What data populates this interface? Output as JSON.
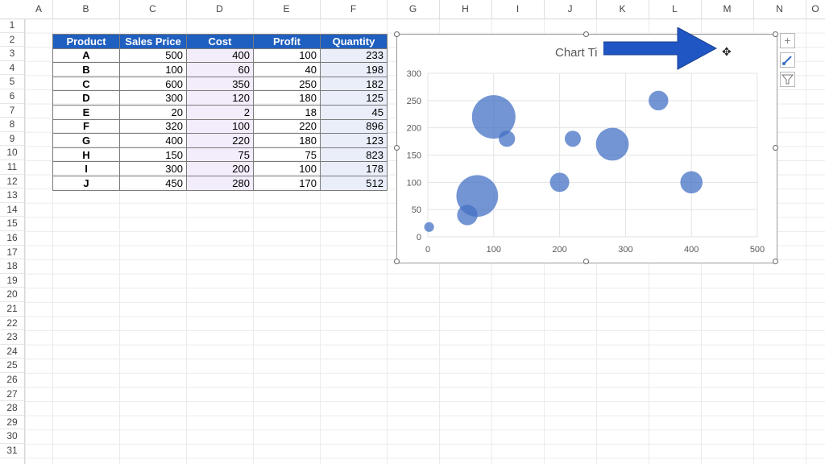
{
  "columns": [
    "A",
    "B",
    "C",
    "D",
    "E",
    "F",
    "G",
    "H",
    "I",
    "J",
    "K",
    "L",
    "M",
    "N",
    "O"
  ],
  "rows": [
    "1",
    "2",
    "3",
    "4",
    "5",
    "6",
    "7",
    "8",
    "9",
    "10",
    "11",
    "12",
    "13",
    "14",
    "15",
    "16",
    "17",
    "18",
    "19",
    "20",
    "21",
    "22",
    "23",
    "24",
    "25",
    "26",
    "27",
    "28",
    "29",
    "30",
    "31"
  ],
  "table": {
    "headers": [
      "Product",
      "Sales Price",
      "Cost",
      "Profit",
      "Quantity"
    ],
    "rows": [
      [
        "A",
        "500",
        "400",
        "100",
        "233"
      ],
      [
        "B",
        "100",
        "60",
        "40",
        "198"
      ],
      [
        "C",
        "600",
        "350",
        "250",
        "182"
      ],
      [
        "D",
        "300",
        "120",
        "180",
        "125"
      ],
      [
        "E",
        "20",
        "2",
        "18",
        "45"
      ],
      [
        "F",
        "320",
        "100",
        "220",
        "896"
      ],
      [
        "G",
        "400",
        "220",
        "180",
        "123"
      ],
      [
        "H",
        "150",
        "75",
        "75",
        "823"
      ],
      [
        "I",
        "300",
        "200",
        "100",
        "178"
      ],
      [
        "J",
        "450",
        "280",
        "170",
        "512"
      ]
    ]
  },
  "chart": {
    "title": "Chart Ti"
  },
  "chart_data": {
    "type": "scatter",
    "subtype": "bubble",
    "title": "Chart Ti",
    "x": [
      400,
      60,
      350,
      120,
      2,
      100,
      220,
      75,
      200,
      280
    ],
    "y": [
      100,
      40,
      250,
      180,
      18,
      220,
      180,
      75,
      100,
      170
    ],
    "size": [
      233,
      198,
      182,
      125,
      45,
      896,
      123,
      823,
      178,
      512
    ],
    "xlim": [
      0,
      500
    ],
    "ylim": [
      0,
      300
    ],
    "xticks": [
      "0",
      "100",
      "200",
      "300",
      "400",
      "500"
    ],
    "yticks": [
      "0",
      "50",
      "100",
      "150",
      "200",
      "250",
      "300"
    ],
    "grid": true,
    "color": "#4472c4"
  },
  "colors": {
    "header_fill": "#1f5fbf",
    "bubble": "#4472c4",
    "arrow": "#1f56c4"
  },
  "icons": [
    "move-cursor-icon",
    "plus-icon",
    "brush-icon",
    "filter-icon"
  ]
}
